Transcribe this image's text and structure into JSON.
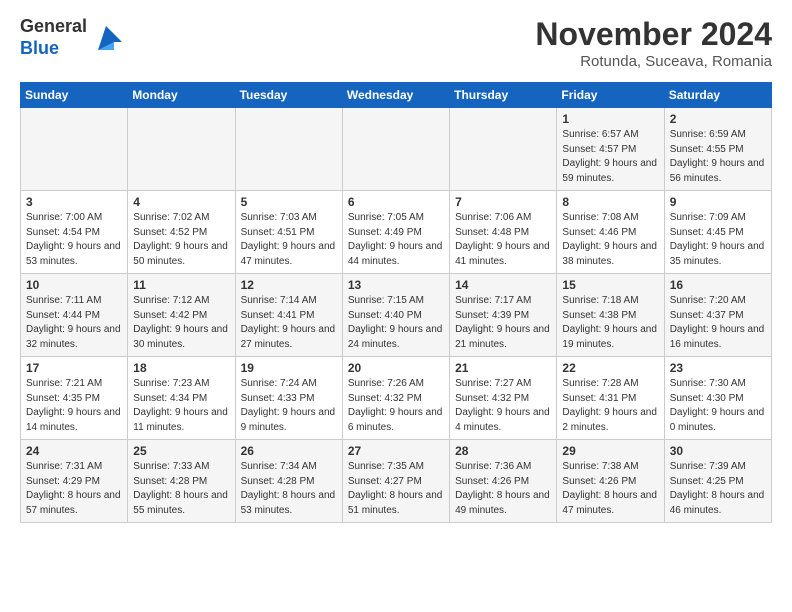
{
  "header": {
    "logo_line1": "General",
    "logo_line2": "Blue",
    "month_title": "November 2024",
    "location": "Rotunda, Suceava, Romania"
  },
  "weekdays": [
    "Sunday",
    "Monday",
    "Tuesday",
    "Wednesday",
    "Thursday",
    "Friday",
    "Saturday"
  ],
  "weeks": [
    [
      {
        "day": "",
        "content": ""
      },
      {
        "day": "",
        "content": ""
      },
      {
        "day": "",
        "content": ""
      },
      {
        "day": "",
        "content": ""
      },
      {
        "day": "",
        "content": ""
      },
      {
        "day": "1",
        "content": "Sunrise: 6:57 AM\nSunset: 4:57 PM\nDaylight: 9 hours and 59 minutes."
      },
      {
        "day": "2",
        "content": "Sunrise: 6:59 AM\nSunset: 4:55 PM\nDaylight: 9 hours and 56 minutes."
      }
    ],
    [
      {
        "day": "3",
        "content": "Sunrise: 7:00 AM\nSunset: 4:54 PM\nDaylight: 9 hours and 53 minutes."
      },
      {
        "day": "4",
        "content": "Sunrise: 7:02 AM\nSunset: 4:52 PM\nDaylight: 9 hours and 50 minutes."
      },
      {
        "day": "5",
        "content": "Sunrise: 7:03 AM\nSunset: 4:51 PM\nDaylight: 9 hours and 47 minutes."
      },
      {
        "day": "6",
        "content": "Sunrise: 7:05 AM\nSunset: 4:49 PM\nDaylight: 9 hours and 44 minutes."
      },
      {
        "day": "7",
        "content": "Sunrise: 7:06 AM\nSunset: 4:48 PM\nDaylight: 9 hours and 41 minutes."
      },
      {
        "day": "8",
        "content": "Sunrise: 7:08 AM\nSunset: 4:46 PM\nDaylight: 9 hours and 38 minutes."
      },
      {
        "day": "9",
        "content": "Sunrise: 7:09 AM\nSunset: 4:45 PM\nDaylight: 9 hours and 35 minutes."
      }
    ],
    [
      {
        "day": "10",
        "content": "Sunrise: 7:11 AM\nSunset: 4:44 PM\nDaylight: 9 hours and 32 minutes."
      },
      {
        "day": "11",
        "content": "Sunrise: 7:12 AM\nSunset: 4:42 PM\nDaylight: 9 hours and 30 minutes."
      },
      {
        "day": "12",
        "content": "Sunrise: 7:14 AM\nSunset: 4:41 PM\nDaylight: 9 hours and 27 minutes."
      },
      {
        "day": "13",
        "content": "Sunrise: 7:15 AM\nSunset: 4:40 PM\nDaylight: 9 hours and 24 minutes."
      },
      {
        "day": "14",
        "content": "Sunrise: 7:17 AM\nSunset: 4:39 PM\nDaylight: 9 hours and 21 minutes."
      },
      {
        "day": "15",
        "content": "Sunrise: 7:18 AM\nSunset: 4:38 PM\nDaylight: 9 hours and 19 minutes."
      },
      {
        "day": "16",
        "content": "Sunrise: 7:20 AM\nSunset: 4:37 PM\nDaylight: 9 hours and 16 minutes."
      }
    ],
    [
      {
        "day": "17",
        "content": "Sunrise: 7:21 AM\nSunset: 4:35 PM\nDaylight: 9 hours and 14 minutes."
      },
      {
        "day": "18",
        "content": "Sunrise: 7:23 AM\nSunset: 4:34 PM\nDaylight: 9 hours and 11 minutes."
      },
      {
        "day": "19",
        "content": "Sunrise: 7:24 AM\nSunset: 4:33 PM\nDaylight: 9 hours and 9 minutes."
      },
      {
        "day": "20",
        "content": "Sunrise: 7:26 AM\nSunset: 4:32 PM\nDaylight: 9 hours and 6 minutes."
      },
      {
        "day": "21",
        "content": "Sunrise: 7:27 AM\nSunset: 4:32 PM\nDaylight: 9 hours and 4 minutes."
      },
      {
        "day": "22",
        "content": "Sunrise: 7:28 AM\nSunset: 4:31 PM\nDaylight: 9 hours and 2 minutes."
      },
      {
        "day": "23",
        "content": "Sunrise: 7:30 AM\nSunset: 4:30 PM\nDaylight: 9 hours and 0 minutes."
      }
    ],
    [
      {
        "day": "24",
        "content": "Sunrise: 7:31 AM\nSunset: 4:29 PM\nDaylight: 8 hours and 57 minutes."
      },
      {
        "day": "25",
        "content": "Sunrise: 7:33 AM\nSunset: 4:28 PM\nDaylight: 8 hours and 55 minutes."
      },
      {
        "day": "26",
        "content": "Sunrise: 7:34 AM\nSunset: 4:28 PM\nDaylight: 8 hours and 53 minutes."
      },
      {
        "day": "27",
        "content": "Sunrise: 7:35 AM\nSunset: 4:27 PM\nDaylight: 8 hours and 51 minutes."
      },
      {
        "day": "28",
        "content": "Sunrise: 7:36 AM\nSunset: 4:26 PM\nDaylight: 8 hours and 49 minutes."
      },
      {
        "day": "29",
        "content": "Sunrise: 7:38 AM\nSunset: 4:26 PM\nDaylight: 8 hours and 47 minutes."
      },
      {
        "day": "30",
        "content": "Sunrise: 7:39 AM\nSunset: 4:25 PM\nDaylight: 8 hours and 46 minutes."
      }
    ]
  ]
}
